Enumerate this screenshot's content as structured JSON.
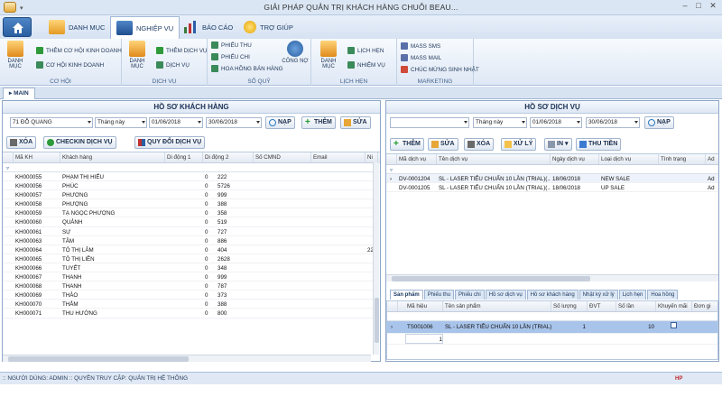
{
  "window": {
    "title": "GIẢI PHÁP QUẢN TRỊ KHÁCH HÀNG CHUỖI BEAU...",
    "minimize": "–",
    "maximize": "□",
    "close": "✕"
  },
  "ribbon_tabs": [
    {
      "label": "DANH MỤC",
      "icon": "folder-icon"
    },
    {
      "label": "NGHIỆP VỤ",
      "icon": "flag-icon"
    },
    {
      "label": "BÁO CÁO",
      "icon": "chart-icon"
    },
    {
      "label": "TRỢ GIÚP",
      "icon": "help-icon"
    }
  ],
  "ribbon": {
    "co_hoi": {
      "label": "CƠ HỘI",
      "danh_muc": "DANH MỤC",
      "them": "THÊM CƠ HỘI KINH DOANH",
      "list": "CƠ HỘI KINH DOANH"
    },
    "dich_vu": {
      "label": "DỊCH VỤ",
      "danh_muc": "DANH MỤC",
      "them": "THÊM DỊCH VỤ",
      "list": "DỊCH VỤ"
    },
    "so_quy": {
      "label": "SỔ QUỸ",
      "phieu_thu": "PHIẾU THU",
      "phieu_chi": "PHIẾU CHI",
      "hoa_hong": "HOA HỒNG BÁN HÀNG",
      "cong_no": "CÔNG NỢ"
    },
    "lich_hen": {
      "label": "LỊCH HẸN",
      "danh_muc": "DANH MỤC",
      "lich_hen": "LỊCH HẸN",
      "nhiem_vu": "NHIỆM VỤ"
    },
    "marketing": {
      "label": "MARKETING",
      "sms": "MASS SMS",
      "mail": "MASS MAIL",
      "chuc_mung": "CHÚC MỪNG SINH NHẬT"
    }
  },
  "doc_tab": "MAIN",
  "left_panel": {
    "title": "HỒ SƠ KHÁCH HÀNG",
    "branch": "71 ĐỖ QUANG",
    "period": "Tháng này",
    "date_from": "01/06/2018",
    "date_to": "30/06/2018",
    "btn_nap": "NẠP",
    "btn_them": "THÊM",
    "btn_sua": "SỬA",
    "btn_xoa": "XÓA",
    "btn_checkin": "CHECKIN DỊCH VỤ",
    "btn_quydoi": "QUY ĐỔI DỊCH VỤ",
    "columns": [
      "Mã KH",
      "Khách hàng",
      "Di động 1",
      "Di động 2",
      "Số CMND",
      "Email",
      "Ni"
    ],
    "rows": [
      [
        "KH000055",
        "PHẠM THỊ HIẾU",
        "",
        "0",
        "222",
        "",
        ""
      ],
      [
        "KH000056",
        "PHÚC",
        "",
        "0",
        "5726",
        "",
        ""
      ],
      [
        "KH000057",
        "PHƯƠNG",
        "",
        "0",
        "999",
        "",
        ""
      ],
      [
        "KH000058",
        "PHƯỢNG",
        "",
        "0",
        "388",
        "",
        ""
      ],
      [
        "KH000059",
        "TẠ NGỌC PHƯỢNG",
        "",
        "0",
        "358",
        "",
        ""
      ],
      [
        "KH000060",
        "QUẢNH",
        "",
        "0",
        "519",
        "",
        ""
      ],
      [
        "KH000061",
        "SỰ",
        "",
        "0",
        "727",
        "",
        ""
      ],
      [
        "KH000063",
        "TÂM",
        "",
        "0",
        "886",
        "",
        ""
      ],
      [
        "KH000064",
        "TÔ THỊ LÂM",
        "",
        "0",
        "404",
        "",
        "22"
      ],
      [
        "KH000065",
        "TÔ THỊ LIÊN",
        "",
        "0",
        "2628",
        "",
        ""
      ],
      [
        "KH000066",
        "TUYẾT",
        "",
        "0",
        "348",
        "",
        ""
      ],
      [
        "KH000067",
        "THANH",
        "",
        "0",
        "999",
        "",
        ""
      ],
      [
        "KH000068",
        "THANH",
        "",
        "0",
        "787",
        "",
        ""
      ],
      [
        "KH000069",
        "THẢO",
        "",
        "0",
        "373",
        "",
        ""
      ],
      [
        "KH000070",
        "THẮM",
        "",
        "0",
        "388",
        "",
        ""
      ],
      [
        "KH000071",
        "THU HƯỜNG",
        "",
        "0",
        "800",
        "",
        ""
      ]
    ]
  },
  "right_panel": {
    "title": "HỒ SƠ DỊCH VỤ",
    "branch": "",
    "period": "Tháng này",
    "date_from": "01/06/2018",
    "date_to": "30/06/2018",
    "btn_nap": "NẠP",
    "btn_them": "THÊM",
    "btn_sua": "SỬA",
    "btn_xoa": "XÓA",
    "btn_xuly": "XỬ LÝ",
    "btn_in": "IN",
    "btn_thutien": "THU TIỀN",
    "columns": [
      "Mã dịch vụ",
      "Tên dịch vụ",
      "Ngày dịch vụ",
      "Loại dịch vụ",
      "Tình trạng",
      "Ad"
    ],
    "rows": [
      [
        "DV-0001204",
        "SL - LASER TIỂU CHUẨN 10 LẦN (TRIAL)(...",
        "18/06/2018",
        "NEW SALE",
        "",
        "Ad"
      ],
      [
        "DV-0001205",
        "SL - LASER TIỂU CHUẨN 10 LẦN (TRIAL)(...",
        "18/06/2018",
        "UP SALE",
        "",
        "Ad"
      ]
    ],
    "subtabs": [
      "Sản phẩm",
      "Phiếu thu",
      "Phiếu chi",
      "Hồ sơ dịch vụ",
      "Hồ sơ khách hàng",
      "Nhật ký xử lý",
      "Lịch hẹn",
      "Hoa hồng"
    ],
    "detail_columns": [
      "Mã hiệu",
      "Tên sản phẩm",
      "Số lượng",
      "ĐVT",
      "Số lần",
      "Khuyến mãi",
      "Đơn gi"
    ],
    "detail_rows": [
      [
        "TS001006",
        "SL - LASER TIỂU CHUẨN 10 LẦN (TRIAL)",
        "1",
        "",
        "10",
        "",
        ""
      ]
    ],
    "detail_footer": "1"
  },
  "status": {
    "text": ":: NGƯỜI DÙNG: ADMIN  :: QUYỀN TRUY CẬP: QUẢN TRỊ HỆ THỐNG",
    "logo": "HP"
  },
  "colors": {
    "accent": "#2a5fa1",
    "ribbon_bg": "#dfe8f5",
    "selected_row": "#a9c4ea"
  }
}
